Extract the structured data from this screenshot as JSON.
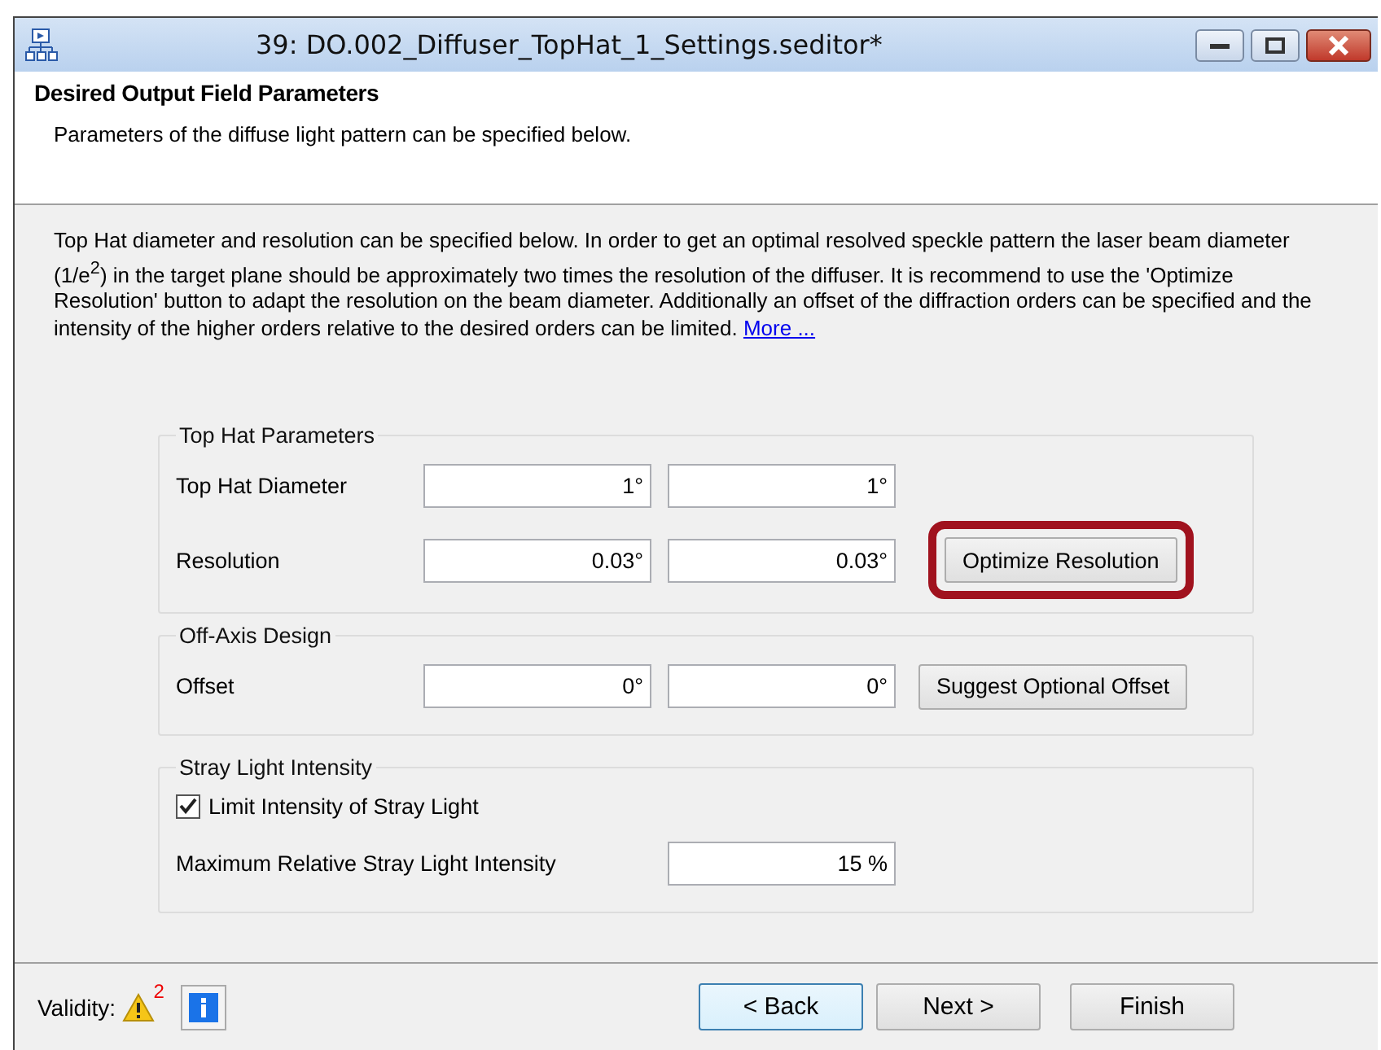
{
  "window": {
    "title": "39: DO.002_Diffuser_TopHat_1_Settings.seditor*"
  },
  "header": {
    "title": "Desired Output Field Parameters",
    "subtitle": "Parameters of the diffuse light pattern can be specified below."
  },
  "description": {
    "text": "Top Hat diameter and resolution can be specified below. In order to get an optimal resolved speckle pattern the laser beam diameter (1/e$^{2}$) in the target plane should be approximately two times the resolution of the diffuser. It is recommend to use the 'Optimize Resolution' button to adapt the resolution on the beam diameter. Additionally an offset of the diffraction orders can be specified and the intensity of the higher orders relative to the desired orders can be limited.",
    "link": "More ..."
  },
  "groups": [
    {
      "title": "Top Hat Parameters",
      "rows": [
        {
          "kind": "pair",
          "label": "Top Hat Diameter",
          "values": [
            "1°",
            "1°"
          ]
        },
        {
          "kind": "pair",
          "label": "Resolution",
          "values": [
            "0.03°",
            "0.03°"
          ],
          "button": {
            "label": "Optimize Resolution",
            "highlighted": true
          }
        }
      ]
    },
    {
      "title": "Off-Axis Design",
      "rows": [
        {
          "kind": "pair",
          "label": "Offset",
          "values": [
            "0°",
            "0°"
          ],
          "button": {
            "label": "Suggest Optional Offset",
            "highlighted": false
          }
        }
      ]
    },
    {
      "title": "Stray Light Intensity",
      "rows": [
        {
          "kind": "checkbox",
          "label": "Limit Intensity of Stray Light",
          "checked": true
        },
        {
          "kind": "single",
          "label": "Maximum Relative Stray Light Intensity",
          "value": "15 %"
        }
      ]
    }
  ],
  "footer": {
    "validity_label": "Validity:",
    "warning_count": "2",
    "buttons": [
      {
        "label": "< Back",
        "selected": true
      },
      {
        "label": "Next >",
        "selected": false
      },
      {
        "label": "Finish",
        "selected": false
      }
    ]
  }
}
